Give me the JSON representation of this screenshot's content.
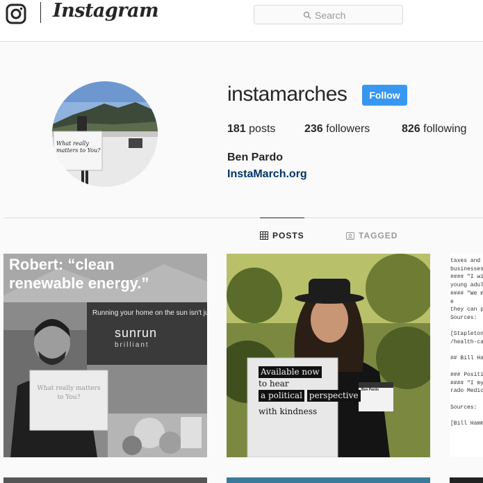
{
  "header": {
    "wordmark": "Instagram",
    "search_placeholder": "Search"
  },
  "profile": {
    "username": "instamarches",
    "follow_label": "Follow",
    "posts_count": "181",
    "posts_label": "posts",
    "followers_count": "236",
    "followers_label": "followers",
    "following_count": "826",
    "following_label": "following",
    "full_name": "Ben Pardo",
    "website": "InstaMarch.org",
    "avatar_sign_text": "What really matters to You?"
  },
  "tabs": [
    {
      "label": "POSTS",
      "active": true,
      "icon": "grid-icon"
    },
    {
      "label": "TAGGED",
      "active": false,
      "icon": "tagged-icon"
    }
  ],
  "posts": [
    {
      "overlay_line1": "Robert: “clean",
      "overlay_line2": "renewable energy.”",
      "banner_text": "Running your home on the sun isn't just sma",
      "brand_name": "sunrun",
      "brand_tag": "brilliant",
      "sign_text": "What really matters to You?"
    },
    {
      "sign_line1": "Available now",
      "sign_line2": "to hear",
      "sign_line3": "a political",
      "sign_line4": "perspective",
      "sign_line5": "with kindness",
      "badge_text": "Ben Pardo"
    },
    {
      "text_lines": [
        "taxes and lea",
        "businesses ou",
        "#### \"I will c",
        "young adults",
        "#### \"We must",
        "e",
        "they can purc",
        "Sources:",
        "",
        "[Stapleton Fo",
        "/health-care/",
        "",
        "## Bill Hammo",
        "",
        "### Positions",
        "#### \"I mysel",
        "rado Medicare",
        "",
        "Sources:",
        "",
        "[Bill Hammons"
      ]
    }
  ],
  "colors": {
    "follow_button": "#3897f0",
    "link": "#003569",
    "border": "#dbdbdb",
    "background": "#fafafa"
  }
}
